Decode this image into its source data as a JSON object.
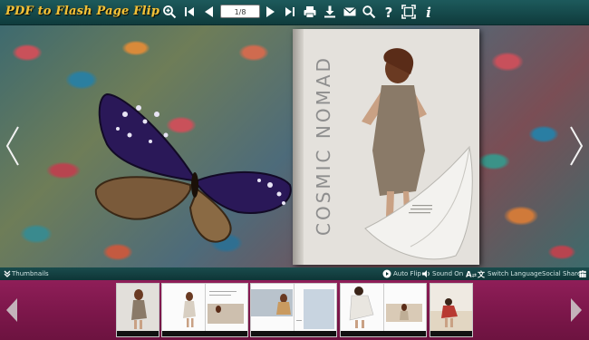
{
  "app": {
    "logo_text": "PDF to Flash Page Flip"
  },
  "toolbar": {
    "page_indicator": "1/8",
    "buttons": [
      {
        "name": "zoom-in",
        "icon": "zoom-in-icon"
      },
      {
        "name": "first-page",
        "icon": "first-page-icon"
      },
      {
        "name": "previous-page",
        "icon": "previous-page-icon"
      },
      {
        "name": "next-page",
        "icon": "next-page-icon"
      },
      {
        "name": "last-page",
        "icon": "last-page-icon"
      },
      {
        "name": "print",
        "icon": "print-icon"
      },
      {
        "name": "download",
        "icon": "download-icon"
      },
      {
        "name": "email",
        "icon": "email-icon"
      },
      {
        "name": "search",
        "icon": "search-icon"
      },
      {
        "name": "help",
        "icon": "help-icon"
      },
      {
        "name": "fullscreen",
        "icon": "fullscreen-icon"
      },
      {
        "name": "info",
        "icon": "info-icon"
      }
    ]
  },
  "book": {
    "cover_title": "COSMIC NOMAD"
  },
  "statusbar": {
    "thumbnails_label": "Thumbnails",
    "auto_flip_label": "Auto Flip",
    "sound_on_label": "Sound On",
    "language_label": "Switch Language",
    "share_label": "Social Share"
  },
  "thumbnails": {
    "count": 5
  },
  "colors": {
    "toolbar_bg": "#0f3b3c",
    "logo": "#f2c23a",
    "thumb_strip": "#7a1649",
    "icon": "#ffffff"
  }
}
